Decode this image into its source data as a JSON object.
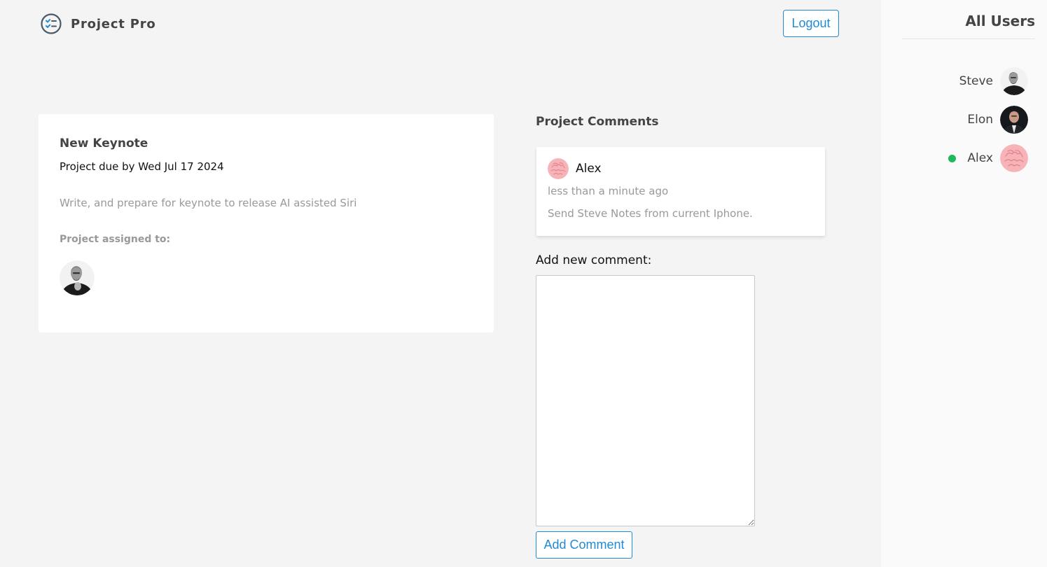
{
  "header": {
    "brand_name": "Project Pro",
    "logout_label": "Logout"
  },
  "project": {
    "title": "New Keynote",
    "due": "Project due by Wed Jul 17 2024",
    "description": "Write, and prepare for keynote to release AI assisted Siri",
    "assigned_label": "Project assigned to:",
    "assigned_avatar": "steve-avatar"
  },
  "comments": {
    "title": "Project Comments",
    "items": [
      {
        "author": "Alex",
        "time": "less than a minute ago",
        "text": "Send Steve Notes from current Iphone.",
        "avatar": "brain-avatar"
      }
    ],
    "add_label": "Add new comment:",
    "textarea_value": "",
    "add_button_label": "Add Comment"
  },
  "sidebar": {
    "title": "All Users",
    "users": [
      {
        "name": "Steve",
        "avatar": "steve-avatar",
        "online": false
      },
      {
        "name": "Elon",
        "avatar": "elon-avatar",
        "online": false
      },
      {
        "name": "Alex",
        "avatar": "brain-avatar",
        "online": true
      }
    ]
  },
  "colors": {
    "accent": "#1f8ad6",
    "online": "#20b85a",
    "background": "#f4f4f4",
    "sidebar_background": "#fafafa"
  }
}
